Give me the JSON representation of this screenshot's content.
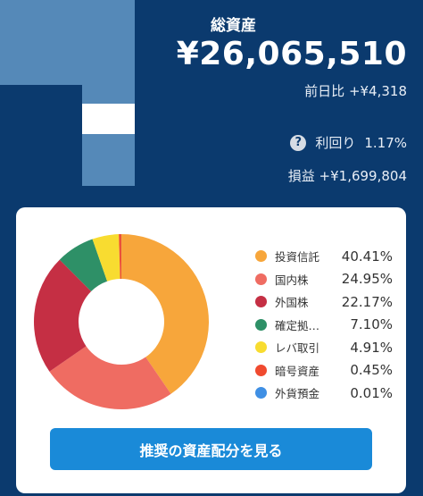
{
  "header": {
    "title": "総資産",
    "total": "¥26,065,510",
    "day_change": "前日比 +¥4,318",
    "yield_label": "利回り",
    "yield_value": "1.17%",
    "profit": "損益 +¥1,699,804",
    "help_icon": "?"
  },
  "colors": {
    "background": "#0b3a6e",
    "button": "#1a8ad8"
  },
  "chart_data": {
    "type": "pie",
    "categories": [
      "投資信託",
      "国内株",
      "外国株",
      "確定拠…",
      "レバ取引",
      "暗号資産",
      "外貨預金"
    ],
    "values": [
      40.41,
      24.95,
      22.17,
      7.1,
      4.91,
      0.45,
      0.01
    ],
    "colors": [
      "#f7a63b",
      "#ef6c62",
      "#c52f44",
      "#2e9067",
      "#f8dc30",
      "#f04a2f",
      "#3f8fe4"
    ],
    "donut": true
  },
  "legend": [
    {
      "name": "投資信託",
      "value": "40.41%"
    },
    {
      "name": "国内株",
      "value": "24.95%"
    },
    {
      "name": "外国株",
      "value": "22.17%"
    },
    {
      "name": "確定拠…",
      "value": "7.10%"
    },
    {
      "name": "レバ取引",
      "value": "4.91%"
    },
    {
      "name": "暗号資産",
      "value": "0.45%"
    },
    {
      "name": "外貨預金",
      "value": "0.01%"
    }
  ],
  "cta": {
    "label": "推奨の資産配分を見る"
  }
}
